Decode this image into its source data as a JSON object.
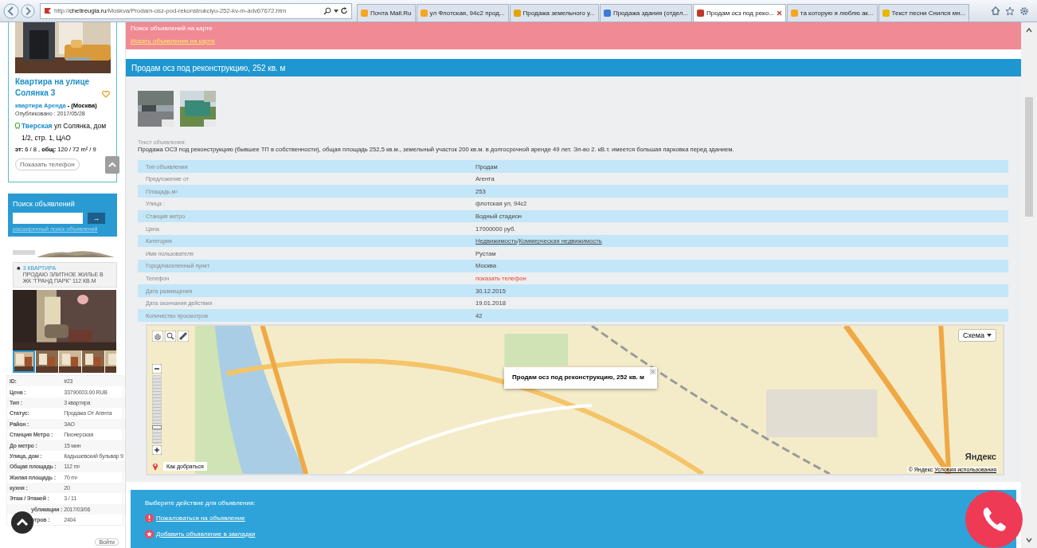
{
  "browser": {
    "url": "http://**chetireugla.ru**/Moskva/Prodam-osz-pod-rekonstrukciyu-252-kv-m-adv67672.htm",
    "tabs": [
      {
        "title": "Почта Mail.Ru",
        "selected": false,
        "color": "#f5a623"
      },
      {
        "title": "ул Флотская, 94с2 прод...",
        "selected": false,
        "color": "#f5a623"
      },
      {
        "title": "Продажа земельного у...",
        "selected": false,
        "color": "#e2a400"
      },
      {
        "title": "Продажа здания (отдел...",
        "selected": false,
        "color": "#3a7bd5"
      },
      {
        "title": "Продам осз под реко...",
        "selected": true,
        "color": "#c0392b"
      },
      {
        "title": "та которую я люблю ак...",
        "selected": false,
        "color": "#f5a623"
      },
      {
        "title": "Текст песни Снился мн...",
        "selected": false,
        "color": "#e6b800"
      }
    ]
  },
  "sidebar": {
    "card": {
      "title": "Квартира на улице Солянка 3",
      "type_link": "квартира Аренда",
      "region": "- (Москва)",
      "published": "Опубликовано : 2017/05/28",
      "metro": "Тверская",
      "address": "ул Солянка, дом 1/2, стр. 1, ЦАО",
      "floor_label": "эт:",
      "floor": "6 / 8 ,",
      "area_label": "общ:",
      "area": "120 / 72 m² / 9",
      "phone_button": "Показать телефон"
    },
    "search": {
      "title": "Поиск объявлений",
      "button": "→",
      "advanced_link": "расширенный поиск объявлений"
    },
    "ad": {
      "category": "3 КВАРТИРА",
      "text": "ПРОДАЮ ЭЛИТНОЕ ЖИЛЬЕ В ЖК \"ГРАНД ПАРК\" 112 КВ.М"
    },
    "thumbnails": [
      {
        "selected": true
      },
      {
        "selected": false
      },
      {
        "selected": false
      },
      {
        "selected": false
      },
      {
        "selected": false
      }
    ],
    "details": [
      {
        "label": "ID:",
        "value": "#23",
        "covered": false
      },
      {
        "label": "Цена :",
        "value": "33790003.00 RUB",
        "covered": false
      },
      {
        "label": "Тип :",
        "value": "3 квартира",
        "covered": false
      },
      {
        "label": "Статус:",
        "value": "Продажа От Агента",
        "covered": false
      },
      {
        "label": "Район :",
        "value": "ЗАО",
        "covered": false
      },
      {
        "label": "Станция Метро :",
        "value": "Пионерская",
        "covered": false
      },
      {
        "label": "До метро :",
        "value": "15 мин",
        "covered": false
      },
      {
        "label": "Улица, дом :",
        "value": "Кадышевский бульвар 9",
        "covered": false
      },
      {
        "label": "Общая площадь :",
        "value": "112 m²",
        "covered": false
      },
      {
        "label": "Жилая площадь :",
        "value": "70 m²",
        "covered": false
      },
      {
        "label": "кухня :",
        "value": "20",
        "covered": false
      },
      {
        "label": "Этаж / Этажей :",
        "value": "3 / 11",
        "covered": false
      },
      {
        "label": "убликации :",
        "value": "2017/03/06",
        "covered": true
      },
      {
        "label": "отров :",
        "value": "2404",
        "covered": true
      }
    ],
    "bottom_button": "Войти"
  },
  "map_search": {
    "title": "Поиск объявлений на карте",
    "link": "Искать объявления на карте"
  },
  "listing": {
    "title": "Продам осз под реконструкцию, 252 кв. м",
    "description_label": "Текст объявления:",
    "description": "Продажа ОСЗ под реконструкцию (бывшее ТП в собственности), общая площадь 252,5 кв.м., земельный участок 200 кв.м. в долгосрочной аренде 49 лет. Эл-во 2. кВ.т. имеется большая парковка перед зданием."
  },
  "properties": [
    {
      "label": "Тип объявления",
      "kind": "text",
      "value": "Продам"
    },
    {
      "label": "Предложение от",
      "kind": "text",
      "value": "Агента"
    },
    {
      "label": "Площадь,м²",
      "kind": "text",
      "value": "253"
    },
    {
      "label": "Улица :",
      "kind": "text",
      "value": "флотская ул, 94с2"
    },
    {
      "label": "Станция метро",
      "kind": "text",
      "value": "Водный стадион"
    },
    {
      "label": "Цена",
      "kind": "text",
      "value": "17000000 руб."
    },
    {
      "label": "Категория",
      "kind": "links",
      "links": [
        "Недвижимость",
        "Коммерческая недвижимость"
      ],
      "separator": "/"
    },
    {
      "label": "Имя пользователя",
      "kind": "text",
      "value": "Рустам"
    },
    {
      "label": "Город/населенный пункт",
      "kind": "text",
      "value": "Москва"
    },
    {
      "label": "Телефон",
      "kind": "action",
      "value": "показать телефон"
    },
    {
      "label": "Дата размещения",
      "kind": "text",
      "value": "30.12.2015"
    },
    {
      "label": "Дата окончания действия",
      "kind": "text",
      "value": "19.01.2018"
    },
    {
      "label": "Количество просмотров",
      "kind": "text",
      "value": "42"
    }
  ],
  "map": {
    "type_button": "Схема",
    "zoom": {
      "level": 0.2
    },
    "balloon": "Продам осз под реконструкцию, 252 кв. м",
    "route_button": "Как добраться",
    "logo": "Яндекс",
    "copyright": "© Яндекс",
    "terms_link": "Условия использования"
  },
  "actions": {
    "title": "Выберите действие для объявления:",
    "items": [
      {
        "kind": "report",
        "label": "Пожаловаться на объявление"
      },
      {
        "kind": "bookmark",
        "label": "Добавить объявление в закладки"
      }
    ]
  }
}
